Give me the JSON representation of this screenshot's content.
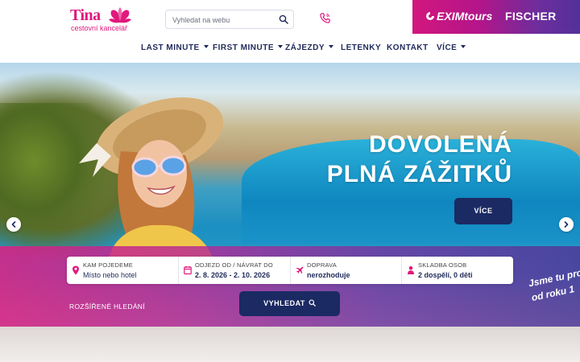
{
  "brand": {
    "name": "Tina",
    "subtitle": "cestovní kancelář",
    "primary_color": "#e0197d",
    "navy_color": "#1b2a63"
  },
  "header": {
    "search_placeholder": "Vyhledat na webu",
    "search_icon": "search-icon",
    "phone_icon": "phone-icon",
    "partners": {
      "exim": "EXIMtours",
      "fischer": "FISCHER"
    }
  },
  "nav": {
    "home_icon": "home-icon",
    "items": [
      {
        "label": "LAST MINUTE",
        "has_dropdown": true
      },
      {
        "label": "FIRST MINUTE",
        "has_dropdown": true
      },
      {
        "label": "ZÁJEZDY",
        "has_dropdown": true
      },
      {
        "label": "LETENKY",
        "has_dropdown": false
      },
      {
        "label": "KONTAKT",
        "has_dropdown": false
      },
      {
        "label": "VÍCE",
        "has_dropdown": true
      }
    ]
  },
  "hero": {
    "title_line1": "DOVOLENÁ",
    "title_line2": "PLNÁ ZÁŽITKŮ",
    "more_button": "VÍCE",
    "slogan_line1": "Jsme tu pro",
    "slogan_line2": "od roku 1"
  },
  "search": {
    "destination": {
      "label": "KAM POJEDEME",
      "value": "Místo nebo hotel"
    },
    "dates": {
      "label": "ODJEZD OD / NÁVRAT DO",
      "value": "2. 8. 2026 - 2. 10. 2026"
    },
    "transport": {
      "label": "DOPRAVA",
      "value": "nerozhoduje"
    },
    "party": {
      "label": "SKLADBA OSOB",
      "value": "2 dospělí, 0 děti"
    },
    "advanced_link": "ROZŠÍŘENÉ HLEDÁNÍ",
    "submit": "VYHLEDAT"
  }
}
